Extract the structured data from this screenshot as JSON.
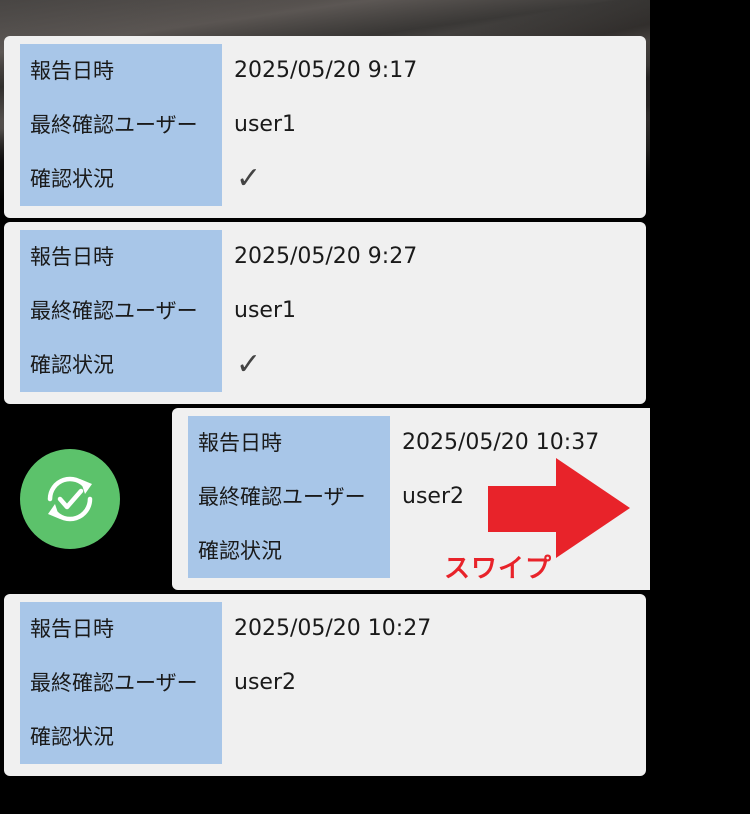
{
  "labels": {
    "report_datetime": "報告日時",
    "last_confirm_user": "最終確認ユーザー",
    "confirm_status": "確認状況"
  },
  "reports": [
    {
      "datetime": "2025/05/20 9:17",
      "user": "user1",
      "status": "✓"
    },
    {
      "datetime": "2025/05/20 9:27",
      "user": "user1",
      "status": "✓"
    },
    {
      "datetime": "2025/05/20 10:37",
      "user": "user2",
      "status": ""
    },
    {
      "datetime": "2025/05/20 10:27",
      "user": "user2",
      "status": ""
    }
  ],
  "swipe_hint": "スワイプ",
  "icons": {
    "sync": "sync-check-icon",
    "arrow": "right-arrow-icon"
  },
  "colors": {
    "card_bg": "#f0f0f0",
    "label_bg": "#a8c6e8",
    "sync_green": "#5cc26b",
    "arrow_red": "#e8232a"
  }
}
